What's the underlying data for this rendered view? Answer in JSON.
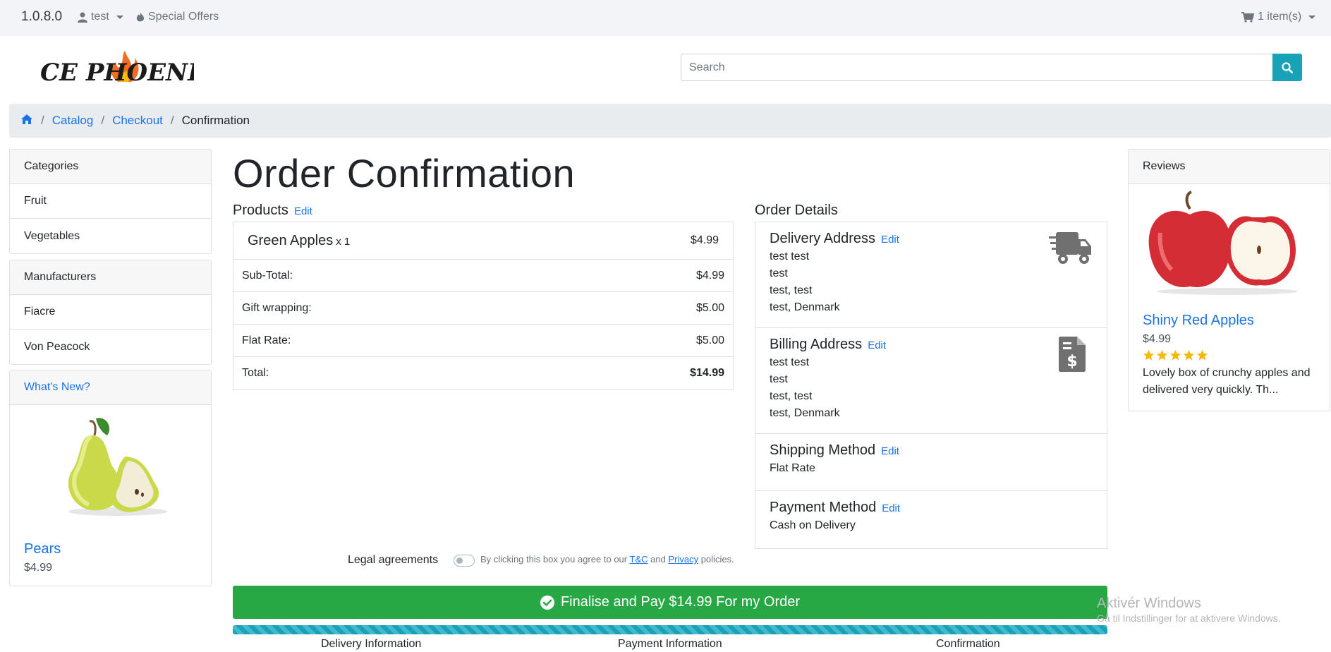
{
  "topbar": {
    "version": "1.0.8.0",
    "user": "test",
    "offers": "Special Offers",
    "cart": "1 item(s)"
  },
  "header": {
    "logo_text": "CE PHOENIX",
    "search_placeholder": "Search"
  },
  "breadcrumb": {
    "items": [
      "Catalog",
      "Checkout"
    ],
    "current": "Confirmation"
  },
  "sidebar": {
    "categories": {
      "title": "Categories",
      "items": [
        "Fruit",
        "Vegetables"
      ]
    },
    "manufacturers": {
      "title": "Manufacturers",
      "items": [
        "Fiacre",
        "Von Peacock"
      ]
    },
    "whats_new": {
      "title": "What's New?",
      "product": "Pears",
      "price": "$4.99"
    }
  },
  "reviews": {
    "title": "Reviews",
    "product": "Shiny Red Apples",
    "price": "$4.99",
    "stars": 5,
    "text_line1": "Lovely box of crunchy apples and",
    "text_line2": "delivered very quickly. Th..."
  },
  "main": {
    "title": "Order Confirmation",
    "products_title": "Products",
    "edit": "Edit",
    "product": {
      "name": "Green Apples",
      "qty": "x 1",
      "price": "$4.99"
    },
    "totals": [
      {
        "label": "Sub-Total:",
        "value": "$4.99"
      },
      {
        "label": "Gift wrapping:",
        "value": "$5.00"
      },
      {
        "label": "Flat Rate:",
        "value": "$5.00"
      },
      {
        "label": "Total:",
        "value": "$14.99"
      }
    ],
    "order_details_title": "Order Details",
    "delivery": {
      "title": "Delivery Address",
      "lines": [
        "test test",
        "test",
        "test, test",
        "test, Denmark"
      ]
    },
    "billing": {
      "title": "Billing Address",
      "lines": [
        "test test",
        "test",
        "test, test",
        "test, Denmark"
      ]
    },
    "shipping": {
      "title": "Shipping Method",
      "value": "Flat Rate"
    },
    "payment": {
      "title": "Payment Method",
      "value": "Cash on Delivery"
    },
    "legal_label": "Legal agreements",
    "legal_text_pre": "By clicking this box you agree to our",
    "legal_tc": "T&C",
    "legal_and": "and",
    "legal_privacy": "Privacy",
    "legal_post": "policies.",
    "finalise_label": "Finalise and Pay $14.99 For my Order",
    "progress": 1.0,
    "steps": [
      "Delivery Information",
      "Payment Information",
      "Confirmation"
    ]
  },
  "watermark": {
    "line1": "Aktivér Windows",
    "line2": "Gå til Indstillinger for at aktivere Windows."
  },
  "colors": {
    "primary": "#1a73e8",
    "success": "#28a745",
    "info": "#17a2b8"
  }
}
